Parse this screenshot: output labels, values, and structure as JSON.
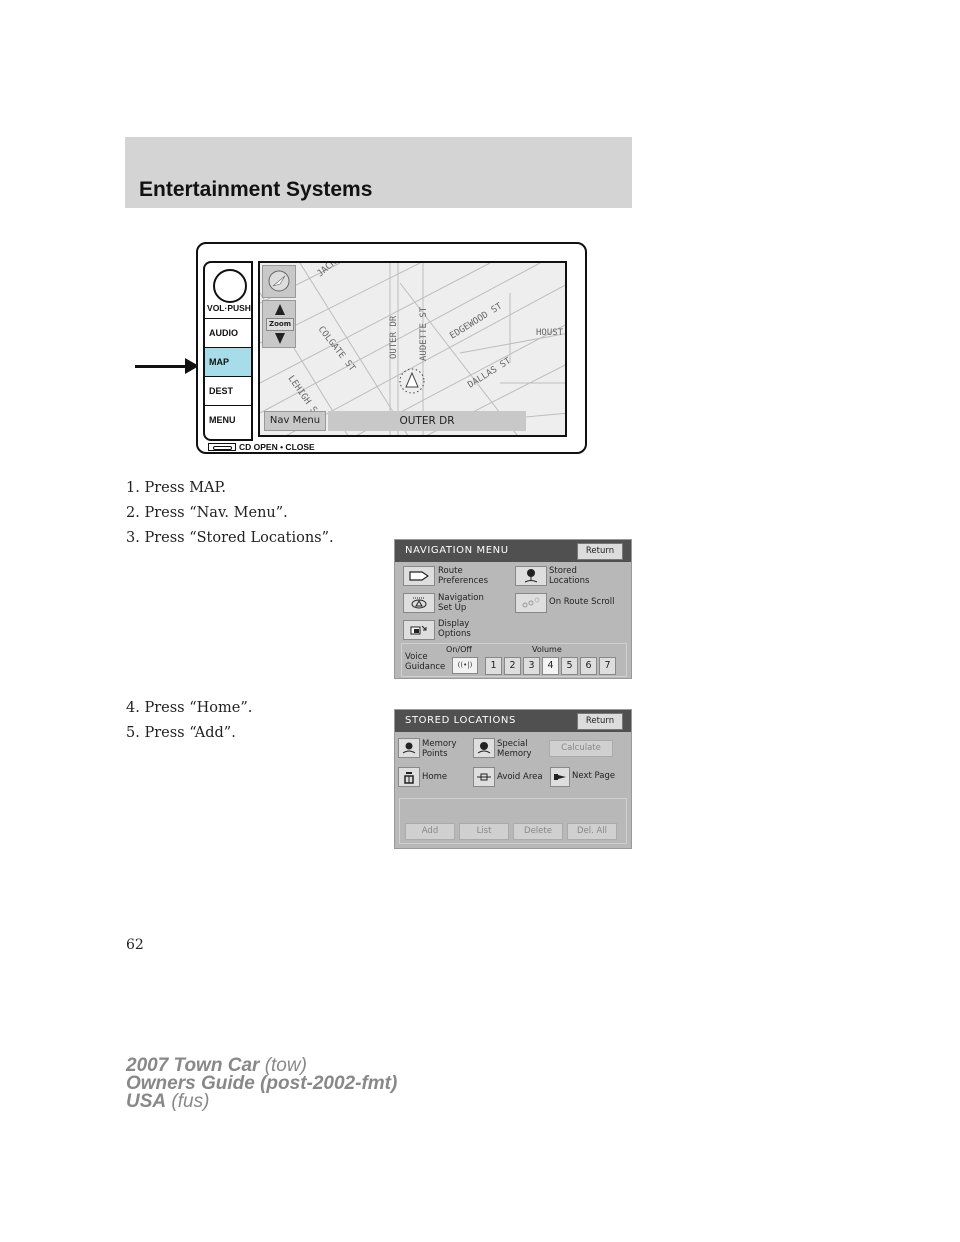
{
  "header": {
    "title": "Entertainment Systems"
  },
  "head_unit": {
    "knob_label": "VOL·PUSH",
    "side_buttons": [
      "AUDIO",
      "MAP",
      "DEST",
      "MENU"
    ],
    "active_button": "MAP",
    "cd_label": "CD OPEN • CLOSE",
    "zoom_label": "Zoom",
    "nav_menu_label": "Nav Menu",
    "current_street": "OUTER DR",
    "map_labels": [
      "JACK",
      "COLGATE ST",
      "LEHIGH S",
      "OUTER DR",
      "AUDETTE ST",
      "EDGEWOOD ST",
      "HOUST",
      "DALLAS ST"
    ],
    "highlight_color": "#a6dde8"
  },
  "steps_a": [
    "1. Press MAP.",
    "2. Press “Nav. Menu”.",
    "3. Press “Stored Locations”."
  ],
  "nav_menu": {
    "title": "NAVIGATION MENU",
    "return_label": "Return",
    "items": [
      {
        "label_line1": "Route",
        "label_line2": "Preferences",
        "icon": "route-icon"
      },
      {
        "label_line1": "Stored",
        "label_line2": "Locations",
        "icon": "pin-icon"
      },
      {
        "label_line1": "Navigation",
        "label_line2": "Set Up",
        "icon": "setup-icon"
      },
      {
        "label_line1": "On Route Scroll",
        "label_line2": "",
        "icon": "scroll-icon"
      },
      {
        "label_line1": "Display",
        "label_line2": "Options",
        "icon": "display-icon"
      }
    ],
    "voice_guidance": {
      "label_line1": "Voice",
      "label_line2": "Guidance",
      "onoff_label": "On/Off",
      "toggle_glyph": "((•|)",
      "volume_label": "Volume",
      "volume_levels": [
        "1",
        "2",
        "3",
        "4",
        "5",
        "6",
        "7"
      ],
      "selected_volume": "4"
    }
  },
  "steps_b": [
    "4. Press “Home”.",
    "5. Press “Add”."
  ],
  "stored_locations": {
    "title": "STORED LOCATIONS",
    "return_label": "Return",
    "items": [
      {
        "label_line1": "Memory",
        "label_line2": "Points"
      },
      {
        "label_line1": "Special",
        "label_line2": "Memory"
      },
      {
        "label_line1": "Home",
        "label_line2": ""
      },
      {
        "label_line1": "Avoid Area",
        "label_line2": ""
      },
      {
        "label_line1": "Next Page",
        "label_line2": ""
      }
    ],
    "calculate_label": "Calculate",
    "bottom_buttons": [
      "Add",
      "List",
      "Delete",
      "Del. All"
    ]
  },
  "page_number": "62",
  "footer": {
    "line1_bold": "2007 Town Car",
    "line1_light": "(tow)",
    "line2_bold": "Owners Guide (post-2002-fmt)",
    "line3_bold": "USA",
    "line3_light": "(fus)"
  }
}
